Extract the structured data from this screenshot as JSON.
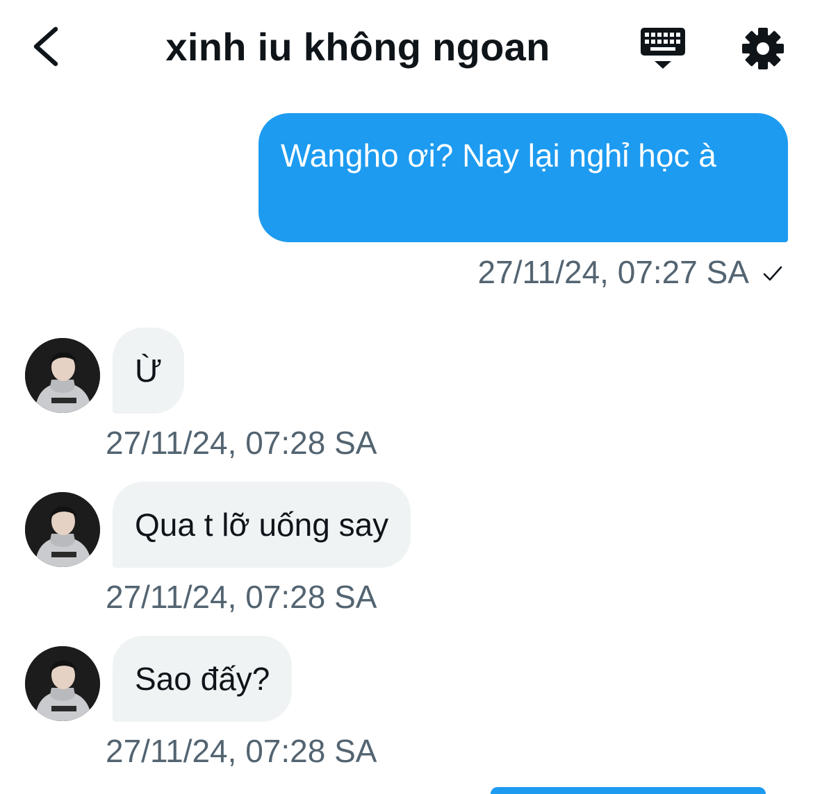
{
  "header": {
    "title": "xinh iu không ngoan",
    "back_icon": "chevron-left-icon",
    "keyboard_icon": "keyboard-hide-icon",
    "settings_icon": "gear-icon"
  },
  "messages": [
    {
      "direction": "outgoing",
      "text": "Wangho ơi? Nay lại nghỉ học à",
      "time": "27/11/24, 07:27 SA",
      "status_icon": "check-icon"
    },
    {
      "direction": "incoming",
      "text": "Ừ",
      "time": "27/11/24, 07:28 SA"
    },
    {
      "direction": "incoming",
      "text": "Qua t lỡ uống say",
      "time": "27/11/24, 07:28 SA"
    },
    {
      "direction": "incoming",
      "text": "Sao đấy?",
      "time": "27/11/24, 07:28 SA"
    }
  ],
  "colors": {
    "outgoing_bubble": "#1d9bf0",
    "incoming_bubble": "#eff3f4",
    "timestamp": "#536471",
    "text": "#0f1419"
  }
}
